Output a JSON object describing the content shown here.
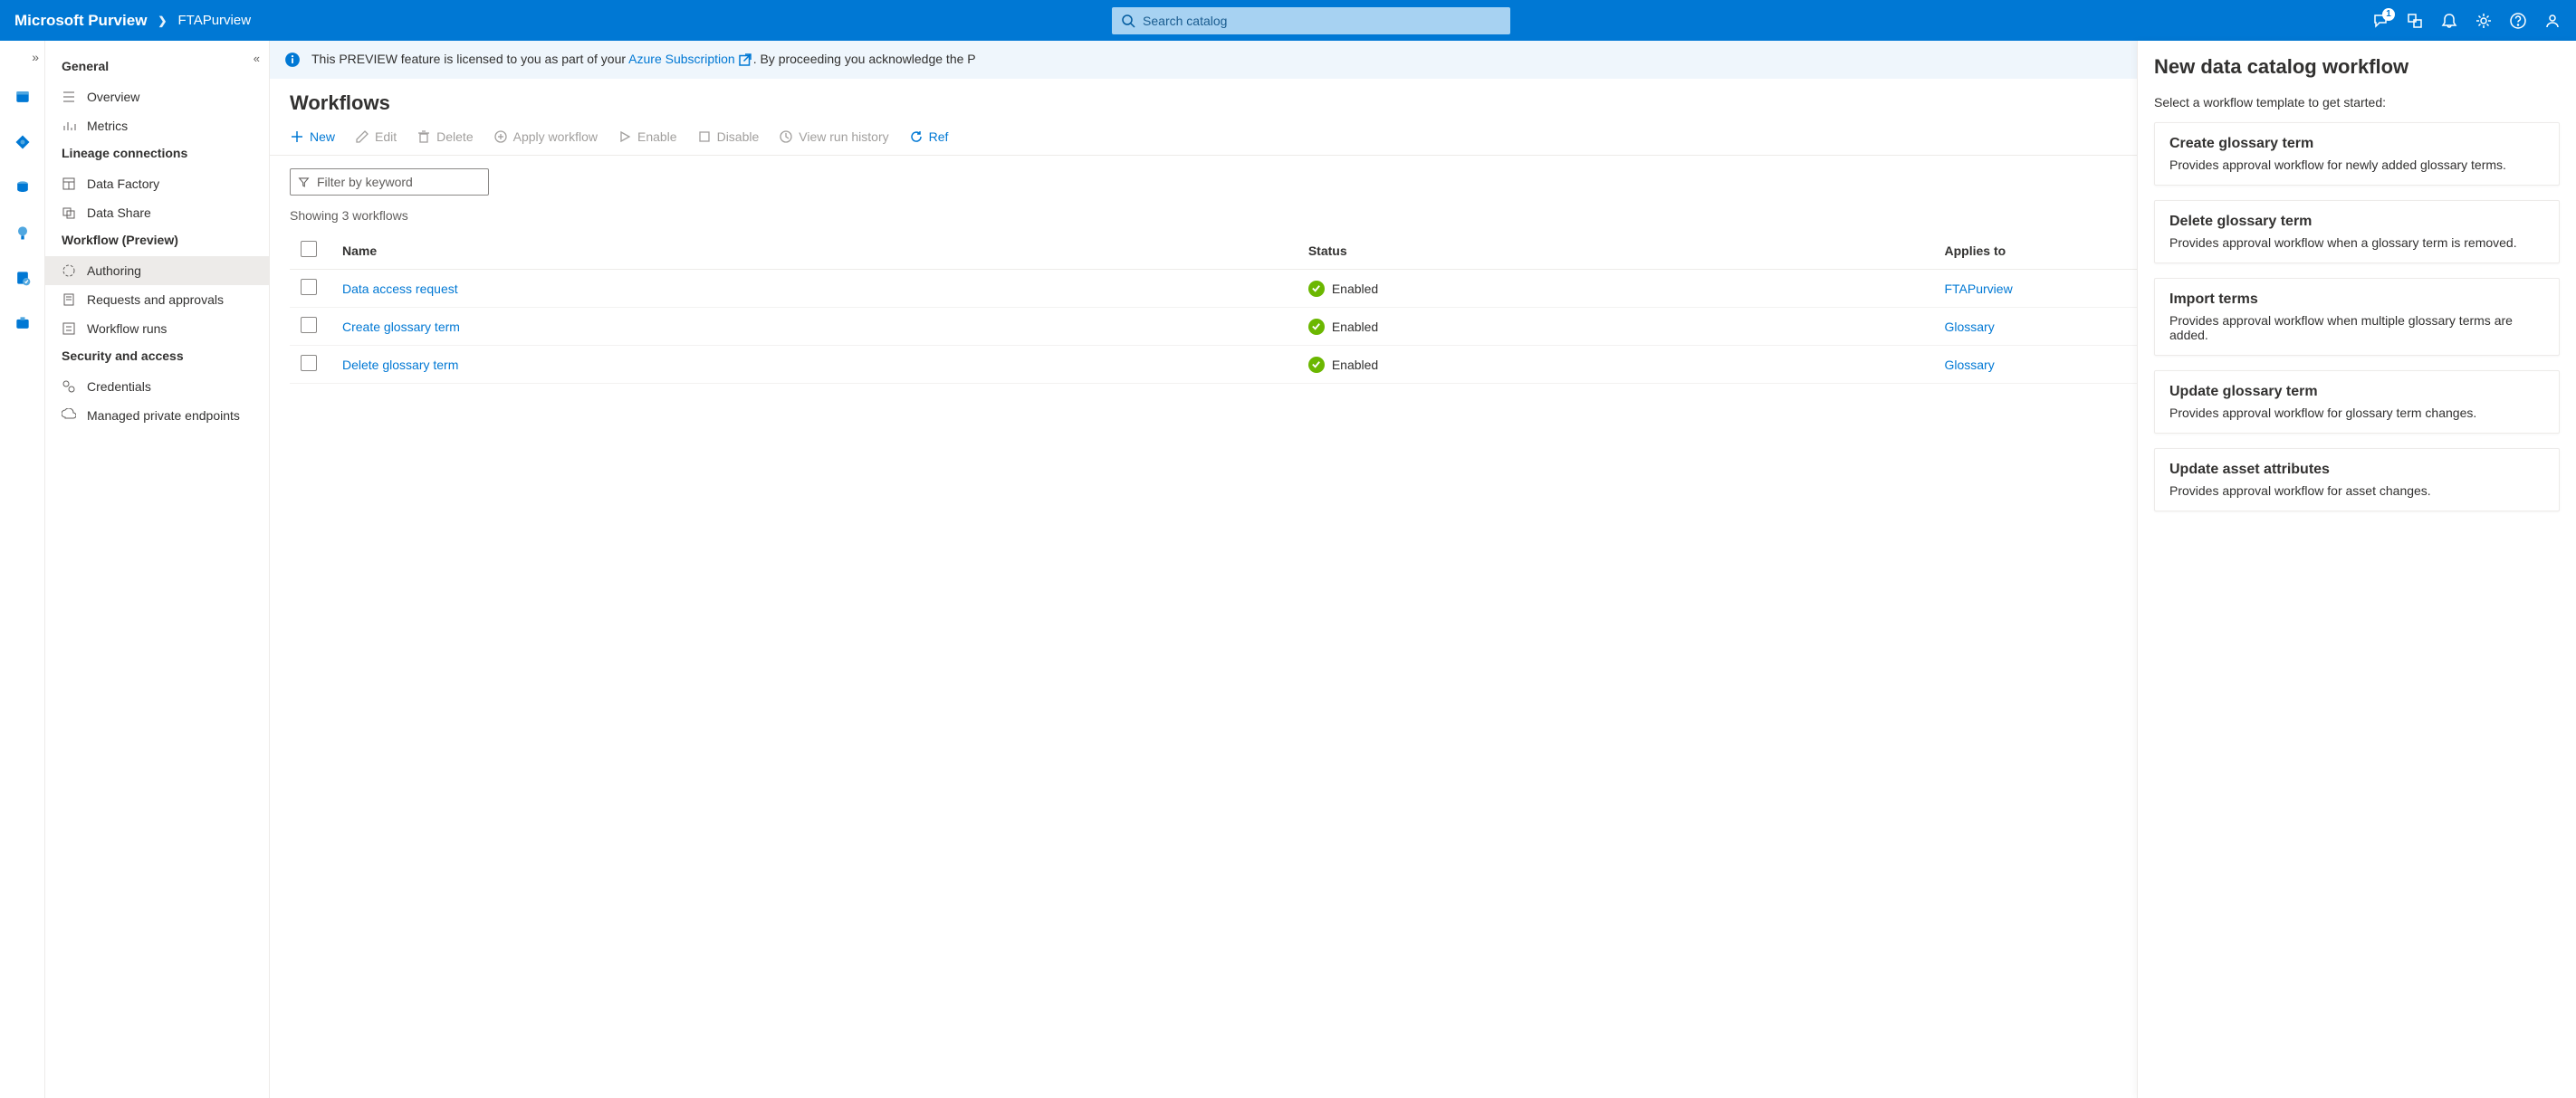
{
  "header": {
    "brand": "Microsoft Purview",
    "account": "FTAPurview",
    "search_placeholder": "Search catalog",
    "notification_badge": "1"
  },
  "sidenav": {
    "groups": [
      {
        "title": "General",
        "items": [
          {
            "label": "Overview"
          },
          {
            "label": "Metrics"
          }
        ]
      },
      {
        "title": "Lineage connections",
        "items": [
          {
            "label": "Data Factory"
          },
          {
            "label": "Data Share"
          }
        ]
      },
      {
        "title": "Workflow (Preview)",
        "items": [
          {
            "label": "Authoring",
            "active": true
          },
          {
            "label": "Requests and approvals"
          },
          {
            "label": "Workflow runs"
          }
        ]
      },
      {
        "title": "Security and access",
        "items": [
          {
            "label": "Credentials"
          },
          {
            "label": "Managed private endpoints"
          }
        ]
      }
    ]
  },
  "banner": {
    "prefix": "This PREVIEW feature is licensed to you as part of your ",
    "link_text": "Azure Subscription",
    "suffix": ". By proceeding you acknowledge the P"
  },
  "page_title": "Workflows",
  "toolbar": {
    "new": "New",
    "edit": "Edit",
    "delete": "Delete",
    "apply": "Apply workflow",
    "enable": "Enable",
    "disable": "Disable",
    "history": "View run history",
    "refresh": "Ref"
  },
  "filter_placeholder": "Filter by keyword",
  "showing_text": "Showing 3 workflows",
  "table": {
    "headers": {
      "name": "Name",
      "status": "Status",
      "applies": "Applies to"
    },
    "status_enabled": "Enabled",
    "rows": [
      {
        "name": "Data access request",
        "applies": "FTAPurview"
      },
      {
        "name": "Create glossary term",
        "applies": "Glossary"
      },
      {
        "name": "Delete glossary term",
        "applies": "Glossary"
      }
    ]
  },
  "panel": {
    "title": "New data catalog workflow",
    "hint": "Select a workflow template to get started:",
    "templates": [
      {
        "title": "Create glossary term",
        "desc": "Provides approval workflow for newly added glossary terms."
      },
      {
        "title": "Delete glossary term",
        "desc": "Provides approval workflow when a glossary term is removed."
      },
      {
        "title": "Import terms",
        "desc": "Provides approval workflow when multiple glossary terms are added."
      },
      {
        "title": "Update glossary term",
        "desc": "Provides approval workflow for glossary term changes."
      },
      {
        "title": "Update asset attributes",
        "desc": "Provides approval workflow for asset changes."
      }
    ]
  }
}
